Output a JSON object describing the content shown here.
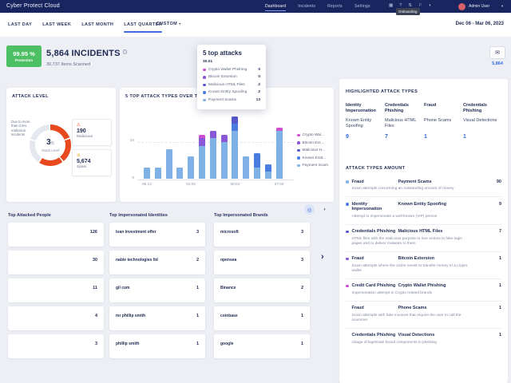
{
  "app": {
    "title": "Cyber Protect Cloud"
  },
  "topnav": {
    "items": [
      {
        "label": "Dashboard",
        "state": "active"
      },
      {
        "label": "Incidents",
        "state": ""
      },
      {
        "label": "Reports",
        "state": ""
      },
      {
        "label": "Settings",
        "state": ""
      }
    ],
    "icons": [
      {
        "glyph": "▦"
      },
      {
        "glyph": "?"
      },
      {
        "glyph": "⇅"
      },
      {
        "glyph": "⚐"
      },
      {
        "glyph": "◗"
      }
    ],
    "user": {
      "name": "Admin User",
      "caret": "▾"
    },
    "tooltip": "Onboarding"
  },
  "tabs": {
    "items": [
      {
        "label": "LAST DAY",
        "state": ""
      },
      {
        "label": "LAST WEEK",
        "state": ""
      },
      {
        "label": "LAST MONTH",
        "state": ""
      },
      {
        "label": "LAST QUARTER",
        "state": "active"
      }
    ],
    "custom_label": "CUSTOM",
    "date_range": "Dec 06 - Mar 06, 2023"
  },
  "incidents": {
    "protection_pct": "99.95 %",
    "protection_label": "Protection",
    "count": "5,864",
    "count_suffix": "INCIDENTS",
    "scanned": "30,737 Items Scanned",
    "mail_count": "5,864"
  },
  "attack_popup": {
    "title": "5 top attacks",
    "date": "30.01",
    "rows": [
      {
        "label": "Crypto Wallet Phishing",
        "value": "0",
        "color": "#cf4fd1"
      },
      {
        "label": "Bitcoin Extorsion",
        "value": "0",
        "color": "#8a57d6"
      },
      {
        "label": "Malicious HTML Files",
        "value": "2",
        "color": "#5558c9"
      },
      {
        "label": "Known Entity Spoofing",
        "value": "2",
        "color": "#4a7ce0"
      },
      {
        "label": "Payment Scams",
        "value": "13",
        "color": "#7fb1e6"
      }
    ]
  },
  "attack_level": {
    "header": "ATTACK LEVEL",
    "note": "Due to more than 0.6% malicious incidents",
    "score": "3",
    "scale": "/5",
    "label": "Attack Level",
    "cards": [
      {
        "value": "190",
        "label": "Malicious"
      },
      {
        "value": "5,674",
        "label": "Spam"
      }
    ]
  },
  "chart_data": {
    "type": "bar",
    "stacked": true,
    "title": "5 TOP ATTACK TYPES OVER TIME",
    "ylim": [
      0,
      18
    ],
    "yticks": [
      0,
      10
    ],
    "grid": "dashed-y",
    "legend_position": "right",
    "x_ticks": [
      {
        "i": 0,
        "label": "06.12"
      },
      {
        "i": 4,
        "label": "02.01"
      },
      {
        "i": 8,
        "label": "30.01"
      },
      {
        "i": 12,
        "label": "27.02"
      }
    ],
    "series": [
      {
        "name": "Crypto Wallet Phishing",
        "legend": "Crypto Wal...",
        "color": "#cf4fd1",
        "values": [
          0,
          0,
          0,
          0,
          0,
          1,
          0,
          0,
          0,
          0,
          0,
          0,
          1
        ]
      },
      {
        "name": "Bitcoin Extorsion",
        "legend": "Bitcoin Ext...",
        "color": "#8a57d6",
        "values": [
          0,
          0,
          0,
          0,
          0,
          2,
          2,
          2,
          0,
          0,
          0,
          0,
          0
        ]
      },
      {
        "name": "Malicious HTML Files",
        "legend": "Malicious H...",
        "color": "#5558c9",
        "values": [
          0,
          0,
          0,
          0,
          0,
          0,
          0,
          0,
          2,
          0,
          0,
          0,
          0
        ]
      },
      {
        "name": "Known Entity Spoofing",
        "legend": "Known Entit...",
        "color": "#4a7ce0",
        "values": [
          0,
          0,
          0,
          0,
          0,
          0,
          0,
          0,
          2,
          0,
          4,
          2,
          0
        ]
      },
      {
        "name": "Payment Scams",
        "legend": "Payment Scam",
        "color": "#7fb1e6",
        "values": [
          3,
          3,
          8,
          3,
          6,
          9,
          11,
          10,
          13,
          6,
          3,
          2,
          13
        ]
      }
    ]
  },
  "highlighted": {
    "header": "HIGHLIGHTED ATTACK TYPES",
    "columns": [
      {
        "category": "Identity Impersonation",
        "subtype": "Known Entity Spoofing",
        "value": "9"
      },
      {
        "category": "Credentials Phishing",
        "subtype": "Malicious HTML Files",
        "value": "7"
      },
      {
        "category": "Fraud",
        "subtype": "Phone Scams",
        "value": "1"
      },
      {
        "category": "Credentials Phishing",
        "subtype": "Visual Detections",
        "value": "1"
      }
    ]
  },
  "amounts": {
    "header": "ATTACK TYPES AMOUNT",
    "items": [
      {
        "dot": "#7fb1e6",
        "category": "Fraud",
        "subtype": "Payment Scams",
        "value": "90",
        "description": "Scam attempts concerning an outstanding amount of money"
      },
      {
        "dot": "#4a7ce0",
        "category": "Identity Impersonation",
        "subtype": "Known Entity Spoofing",
        "value": "9",
        "description": "Attempt to impersonate a well-known (VIP) person"
      },
      {
        "dot": "#5558c9",
        "category": "Credentials Phishing",
        "subtype": "Malicious HTML Files",
        "value": "7",
        "description": "HTML files with the malicious purpose to lure victims to fake login pages and to deliver malware to them"
      },
      {
        "dot": "#8a57d6",
        "category": "Fraud",
        "subtype": "Bitcoin Extorsion",
        "value": "1",
        "description": "Scam attempts where the victim needs to transfer money to a crypto wallet"
      },
      {
        "dot": "#cf4fd1",
        "category": "Credit Card Phishing",
        "subtype": "Crypto Wallet Phishing",
        "value": "1",
        "description": "Impersonation attempt to Crypto related brands"
      },
      {
        "dot": "transparent",
        "category": "Fraud",
        "subtype": "Phone Scams",
        "value": "1",
        "description": "Scam attempts with fake invoices that require the user to call the scammer"
      },
      {
        "dot": "transparent",
        "category": "Credentials Phishing",
        "subtype": "Visual Detections",
        "value": "1",
        "description": "Usage of legitimate brand components in phishing"
      }
    ]
  },
  "lists": {
    "people": {
      "title": "Top Attacked People",
      "rows": [
        {
          "label": "",
          "value": "126"
        },
        {
          "label": "",
          "value": "30"
        },
        {
          "label": "",
          "value": "11"
        },
        {
          "label": "",
          "value": "4"
        },
        {
          "label": "",
          "value": "3"
        }
      ]
    },
    "identities": {
      "title": "Top Impersonated Identities",
      "rows": [
        {
          "label": "loan investment offer",
          "value": "3"
        },
        {
          "label": "nable technologies ltd",
          "value": "2"
        },
        {
          "label": "gil com",
          "value": "1"
        },
        {
          "label": "mr phillip smith",
          "value": "1"
        },
        {
          "label": "phillip smith",
          "value": "1"
        }
      ]
    },
    "brands": {
      "title": "Top Impersonated Brands",
      "rows": [
        {
          "label": "microsoft",
          "value": "3"
        },
        {
          "label": "opensea",
          "value": "3"
        },
        {
          "label": "Binance",
          "value": "2"
        },
        {
          "label": "coinbase",
          "value": "1"
        },
        {
          "label": "google",
          "value": "1"
        }
      ]
    }
  },
  "colors": {
    "accent": "#2f6bdb",
    "green": "#4cc062",
    "red": "#e8491f",
    "yellow": "#f2a51b",
    "navy": "#18255e"
  }
}
